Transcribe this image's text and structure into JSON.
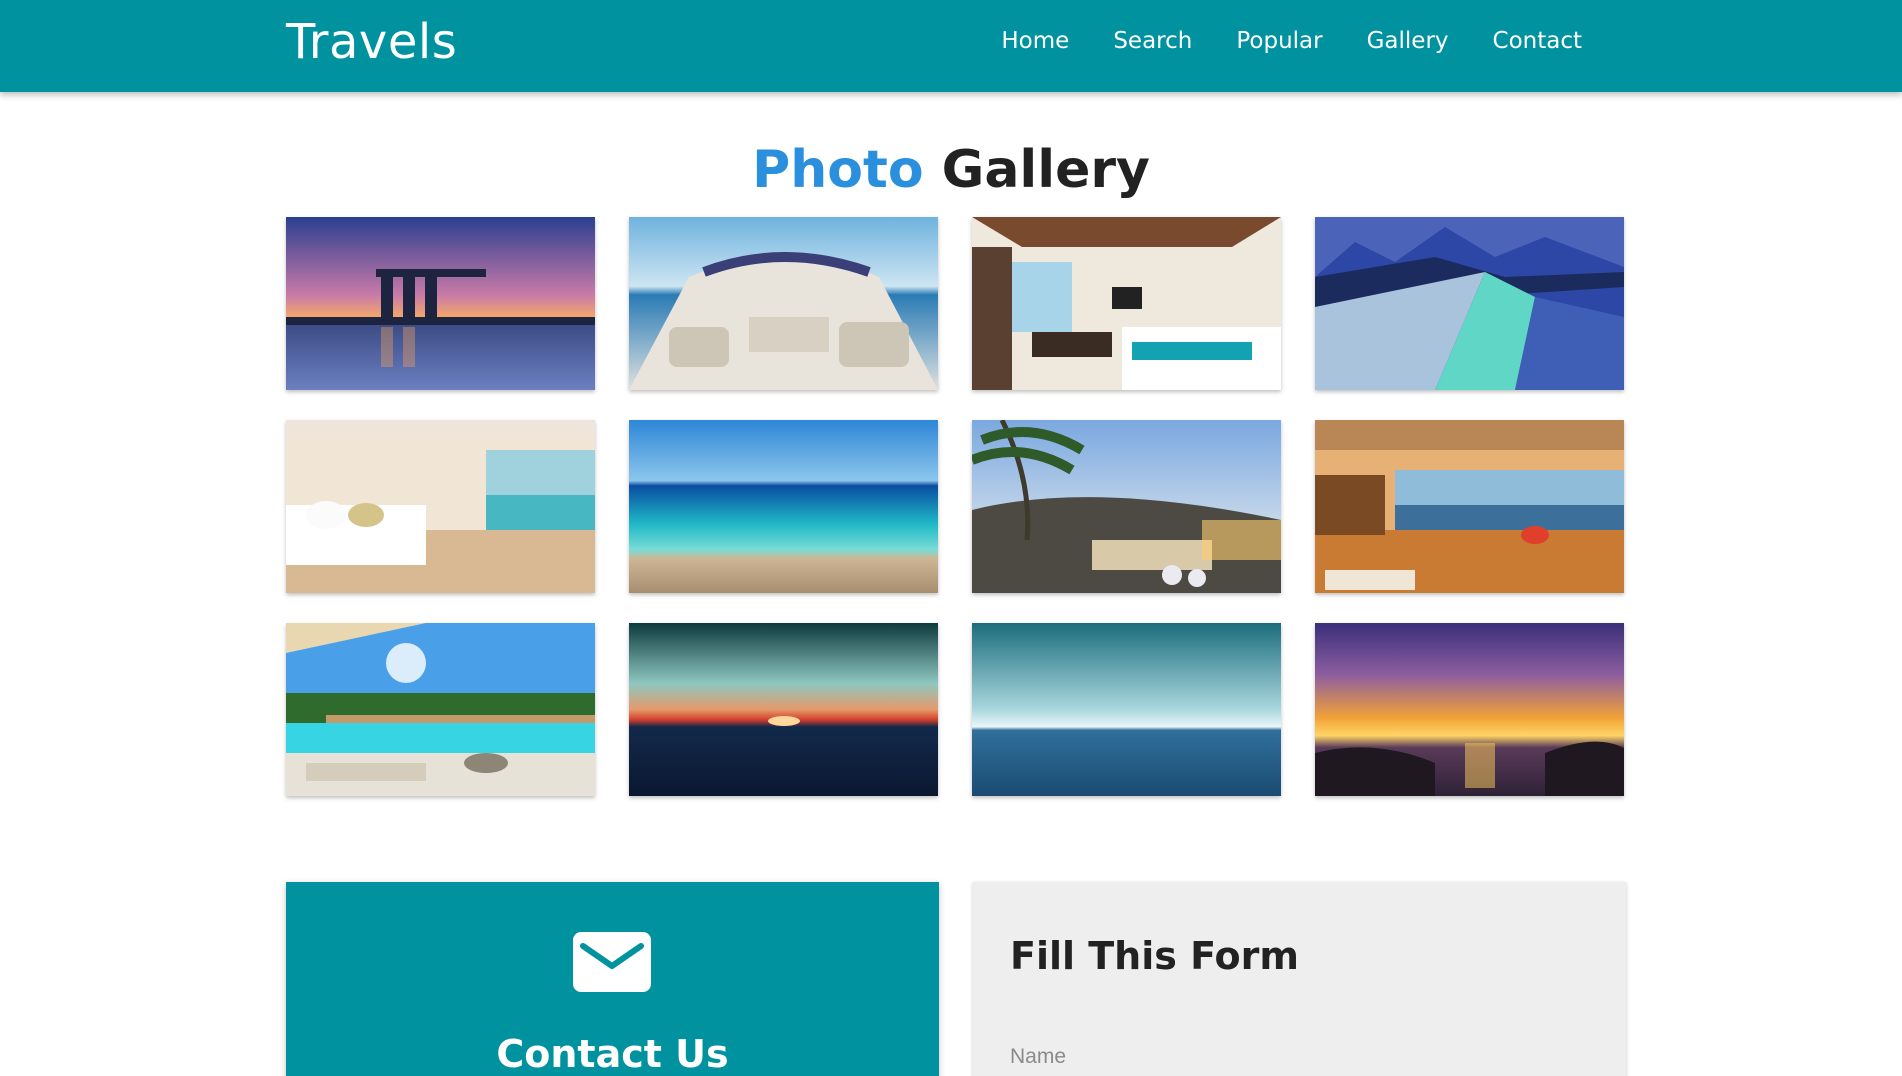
{
  "brand": "Travels",
  "nav": {
    "items": [
      "Home",
      "Search",
      "Popular",
      "Gallery",
      "Contact"
    ]
  },
  "gallery": {
    "title_accent": "Photo",
    "title_rest": "Gallery"
  },
  "contact": {
    "title": "Contact Us",
    "icon": "envelope-icon"
  },
  "form": {
    "title": "Fill This Form",
    "name_placeholder": "Name"
  },
  "colors": {
    "header": "#00939f",
    "accent": "#2a8fdd",
    "form_bg": "#eeeeee"
  }
}
